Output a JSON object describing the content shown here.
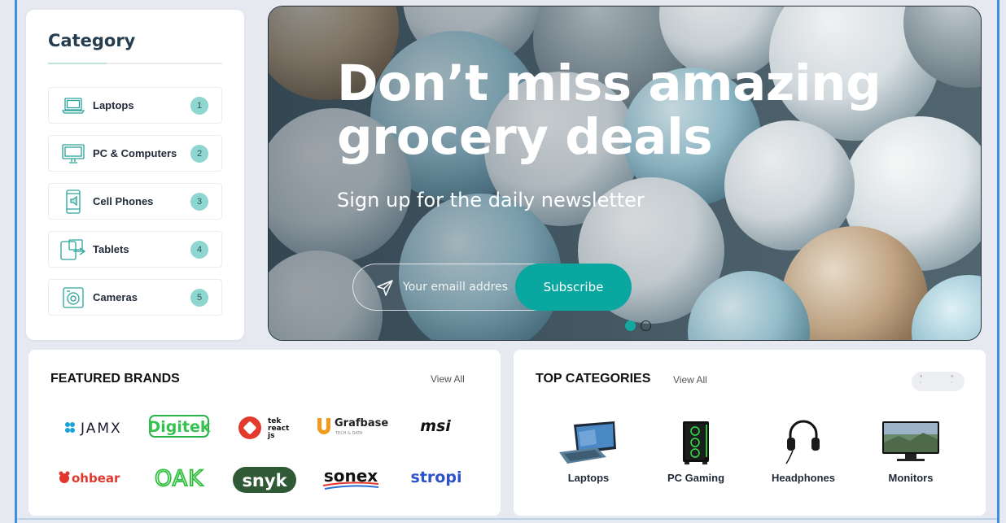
{
  "sidebar": {
    "title": "Category",
    "items": [
      {
        "label": "Laptops",
        "count": "1",
        "icon": "laptop-icon"
      },
      {
        "label": "PC & Computers",
        "count": "2",
        "icon": "monitor-icon"
      },
      {
        "label": "Cell Phones",
        "count": "3",
        "icon": "phone-icon"
      },
      {
        "label": "Tablets",
        "count": "4",
        "icon": "tablet-icon"
      },
      {
        "label": "Cameras",
        "count": "5",
        "icon": "camera-icon"
      }
    ]
  },
  "hero": {
    "title_line1": "Don’t miss amazing",
    "title_line2": "grocery deals",
    "subtitle": "Sign up for the daily newsletter",
    "email_placeholder": "Your emaill address",
    "subscribe_label": "Subscribe",
    "slides": 2,
    "active_slide": 1
  },
  "featured_brands": {
    "title": "FEATURED BRANDS",
    "view_all": "View All",
    "brands": [
      "JAMX",
      "Digitek",
      "tek react js",
      "Grafbase",
      "TECH & DATA",
      "msi",
      "ohbear",
      "OAK",
      "snyk",
      "sonex",
      "stropi"
    ]
  },
  "top_categories": {
    "title": "TOP CATEGORIES",
    "view_all": "View All",
    "items": [
      {
        "label": "Laptops"
      },
      {
        "label": "PC Gaming"
      },
      {
        "label": "Headphones"
      },
      {
        "label": "Monitors"
      }
    ]
  },
  "colors": {
    "accent": "#0aa6a0",
    "badge": "#8ed6d0",
    "page_bg": "#e6e9ef",
    "heading": "#253d4e"
  }
}
